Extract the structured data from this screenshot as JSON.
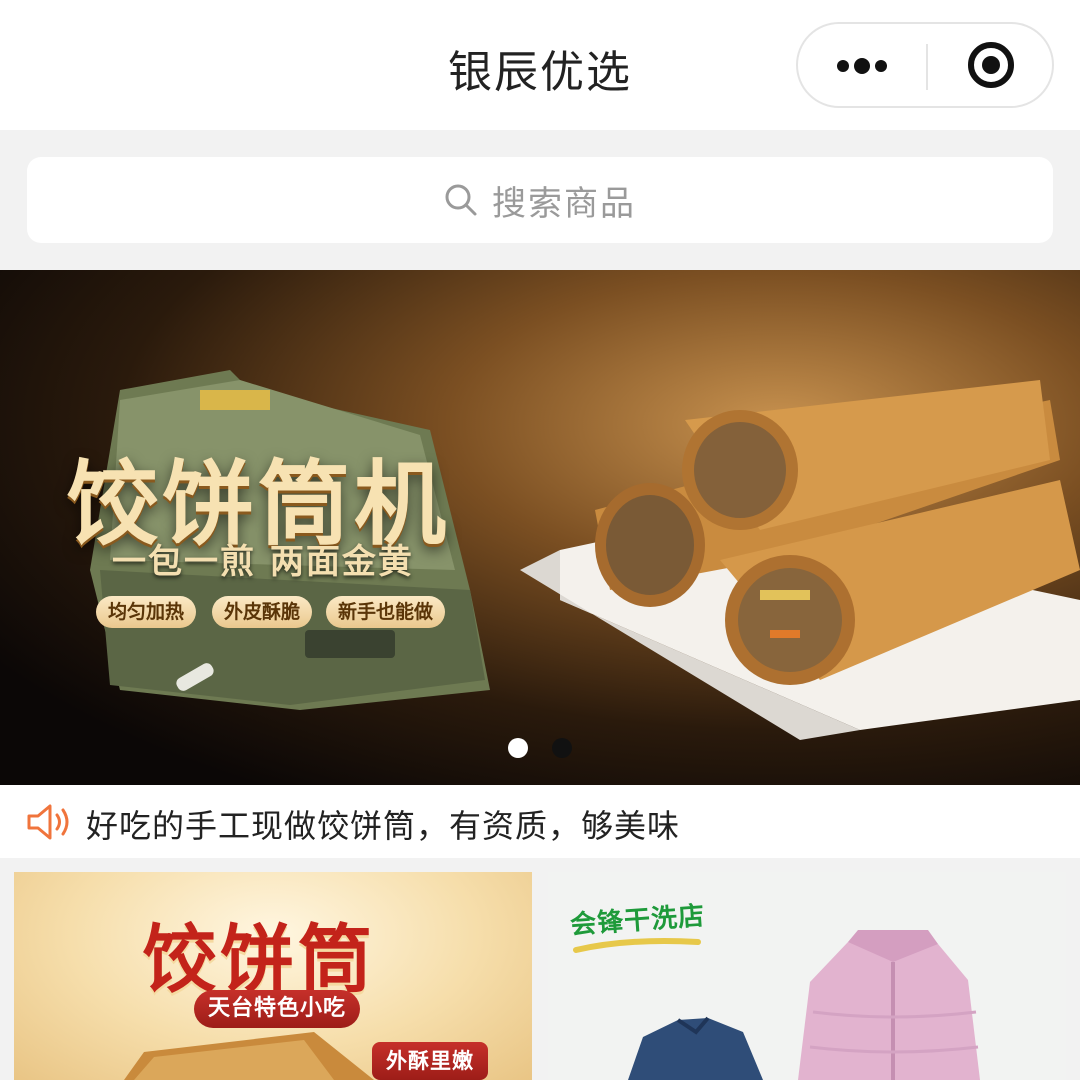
{
  "navbar": {
    "title": "银辰优选",
    "more_icon": "more-dots-icon",
    "close_icon": "target-close-icon"
  },
  "search": {
    "icon": "search-icon",
    "placeholder": "搜索商品"
  },
  "banner": {
    "title": "饺饼筒机",
    "subtitle": "一包一煎 两面金黄",
    "tags": [
      "均匀加热",
      "外皮酥脆",
      "新手也能做"
    ],
    "pages": 2,
    "active_page": 1
  },
  "notice": {
    "icon": "speaker-icon",
    "text": "好吃的手工现做饺饼筒，有资质，够美味"
  },
  "cards": {
    "left": {
      "title": "饺饼筒",
      "subtitle": "天台特色小吃",
      "badge": "外酥里嫩"
    },
    "right": {
      "brand": "会锋干洗店"
    }
  },
  "colors": {
    "accent_red": "#c3231a",
    "notice_icon": "#f0743c",
    "brand_green": "#1e9a3a"
  }
}
